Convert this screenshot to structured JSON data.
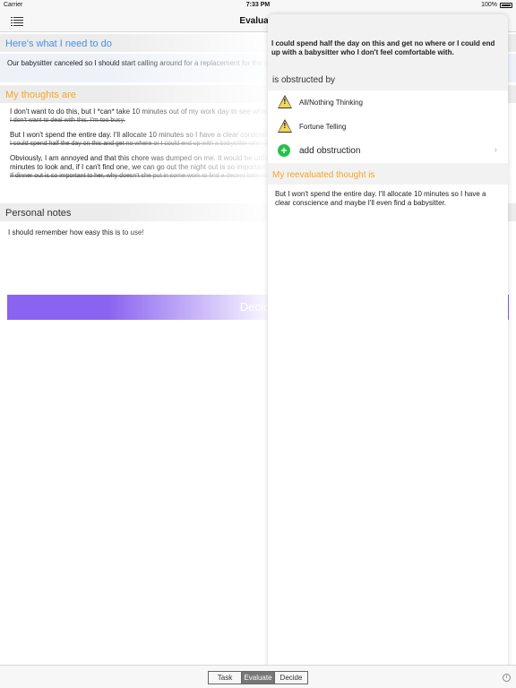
{
  "status_bar": {
    "carrier": "Carrier",
    "time": "7:33 PM",
    "battery": "100%"
  },
  "nav": {
    "title": "Evaluate"
  },
  "task_section": {
    "header": "Here's what I need to do",
    "text": "Our babysitter canceled so I should start calling around for a replacement for the evening"
  },
  "thoughts_section": {
    "header": "My thoughts are",
    "items": [
      {
        "text": "I don't want to do this, but I *can* take 10 minutes out of my work day to see what happens and I can say I tried.",
        "struck": "I don't want to deal with this. I'm too busy."
      },
      {
        "text": "But I won't spend the entire day. I'll allocate 10 minutes so I have a clear conscience and maybe I'll even find a babysitter.",
        "struck": "I could spend half the day on this and get no where or I could end up with a babysitter who I don't feel comfortable with."
      },
      {
        "text": "Obviously, I am annoyed and that this chore was dumped on me. It would be unfair if she got annoyed because I didn't try to find a babysitter. I can take 10 minutes to look and, if I can't find one, we can go out the night out is so important.",
        "struck": "If dinner out is so important to her, why doesn't she put in some work to find a decent babysitter?"
      }
    ]
  },
  "notes_section": {
    "header": "Personal notes",
    "text": "I should remember how easy this is to use!"
  },
  "decide_button": {
    "label": "Decide"
  },
  "popover": {
    "thought": "I could spend half the day on this and get no where or I could end up with a babysitter who I don't feel comfortable with.",
    "obstructed_label": "is obstructed by",
    "obstructions": [
      {
        "label": "All/Nothing Thinking",
        "icon": "warning-icon"
      },
      {
        "label": "Fortune Telling",
        "icon": "warning-icon"
      }
    ],
    "add_label": "add obstruction",
    "reevaluated_header": "My reevaluated thought is",
    "reevaluated_text": "But I won't spend the entire day. I'll allocate 10 minutes so I have a clear conscience and maybe I'll even find a babysitter."
  },
  "segments": {
    "task": "Task",
    "evaluate": "Evaluate",
    "decide": "Decide"
  },
  "colors": {
    "accent_purple": "#8a63f0",
    "header_blue": "#4a90e2",
    "header_orange": "#f5a623",
    "add_green": "#27c04c"
  }
}
